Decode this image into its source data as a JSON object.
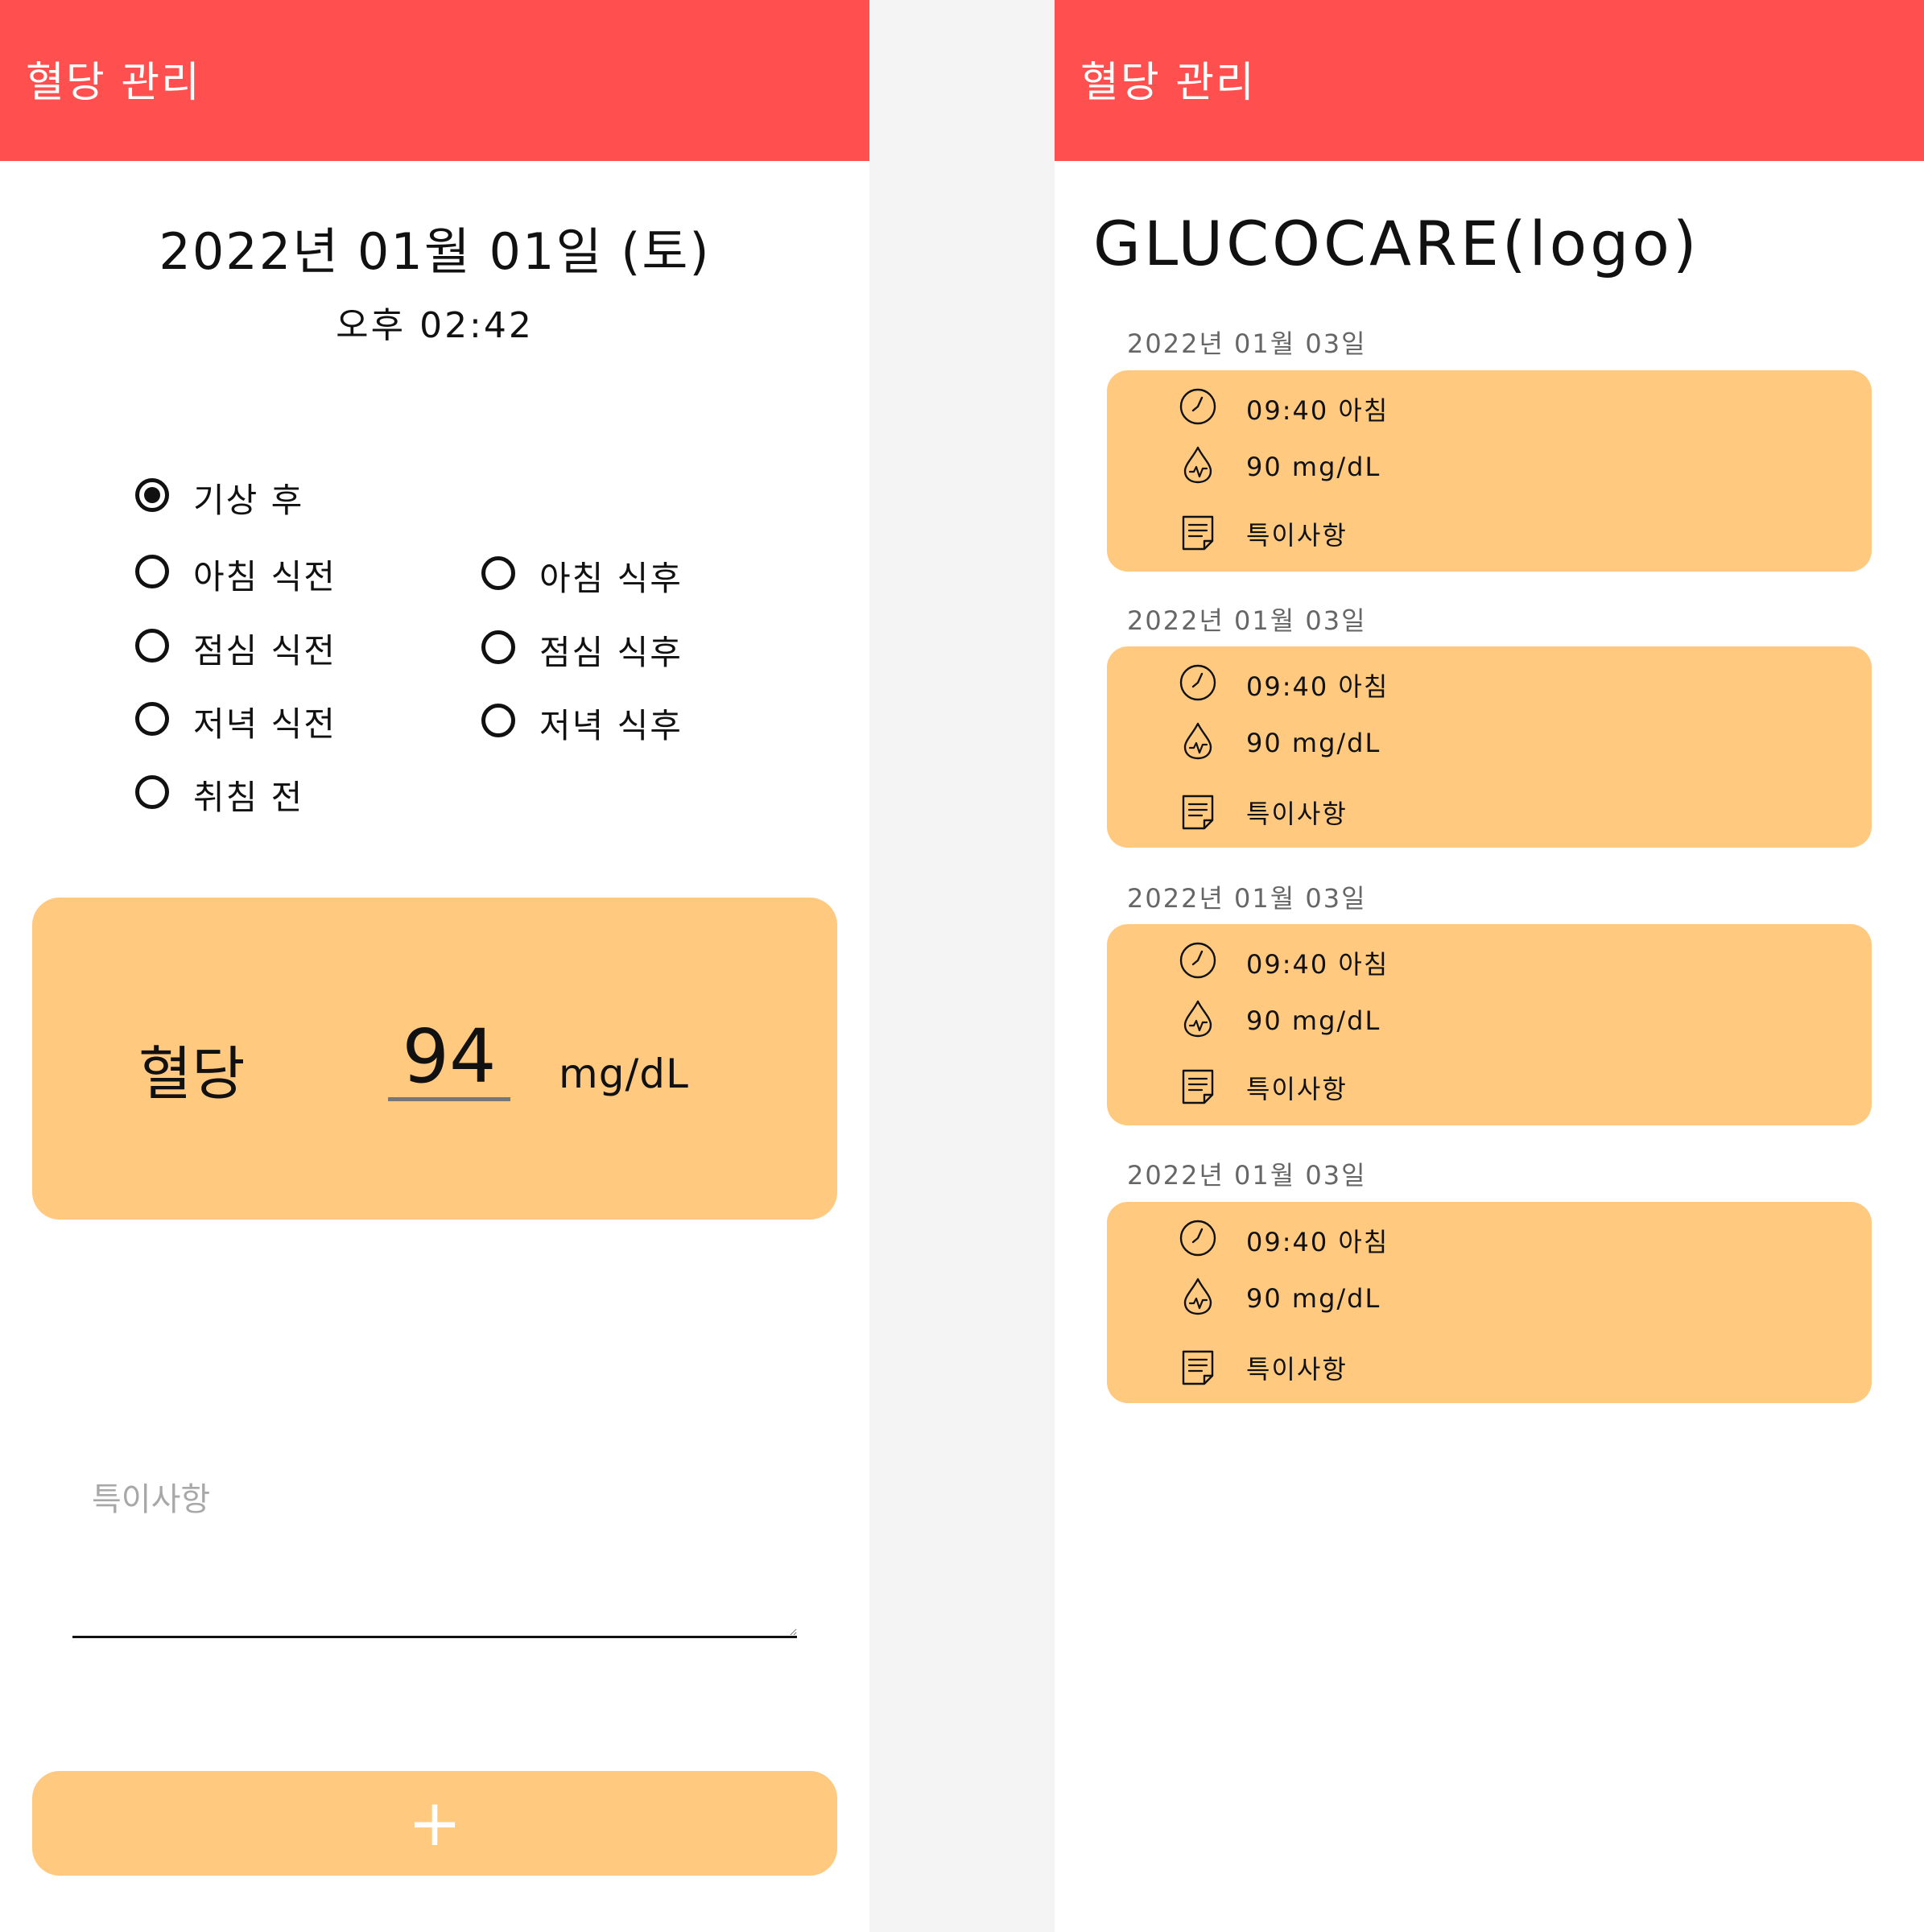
{
  "left_screen": {
    "app_bar": {
      "title": "혈당 관리"
    },
    "date": "2022년 01월 01일 (토)",
    "time": "오후 02:42",
    "radio_options": [
      {
        "label": "기상 후",
        "checked": true
      },
      {
        "label": "아침 식전",
        "checked": false
      },
      {
        "label": "아침 식후",
        "checked": false
      },
      {
        "label": "점심 식전",
        "checked": false
      },
      {
        "label": "점심 식후",
        "checked": false
      },
      {
        "label": "저녁 식전",
        "checked": false
      },
      {
        "label": "저녁 식후",
        "checked": false
      },
      {
        "label": "취침 전",
        "checked": false
      }
    ],
    "glucose": {
      "label": "혈당",
      "value": "94",
      "unit": "mg/dL"
    },
    "notes": {
      "placeholder": "특이사항",
      "value": ""
    },
    "add_button": {
      "label": "+"
    }
  },
  "right_screen": {
    "app_bar": {
      "title": "혈당 관리"
    },
    "logo": "GLUCOCARE(logo)",
    "entries": [
      {
        "date": "2022년 01월 03일",
        "time": "09:40 아침",
        "glucose": "90 mg/dL",
        "note": "특이사항"
      },
      {
        "date": "2022년 01월 03일",
        "time": "09:40 아침",
        "glucose": "90 mg/dL",
        "note": "특이사항"
      },
      {
        "date": "2022년 01월 03일",
        "time": "09:40 아침",
        "glucose": "90 mg/dL",
        "note": "특이사항"
      },
      {
        "date": "2022년 01월 03일",
        "time": "09:40 아침",
        "glucose": "90 mg/dL",
        "note": "특이사항"
      }
    ],
    "icons": {
      "time": "clock-icon",
      "glucose": "blood-drop-icon",
      "note": "memo-icon"
    }
  },
  "colors": {
    "app_bar": "#ff4f4f",
    "card": "#ffc97f",
    "background": "#f4f4f4",
    "placeholder": "#a8a8a8"
  }
}
